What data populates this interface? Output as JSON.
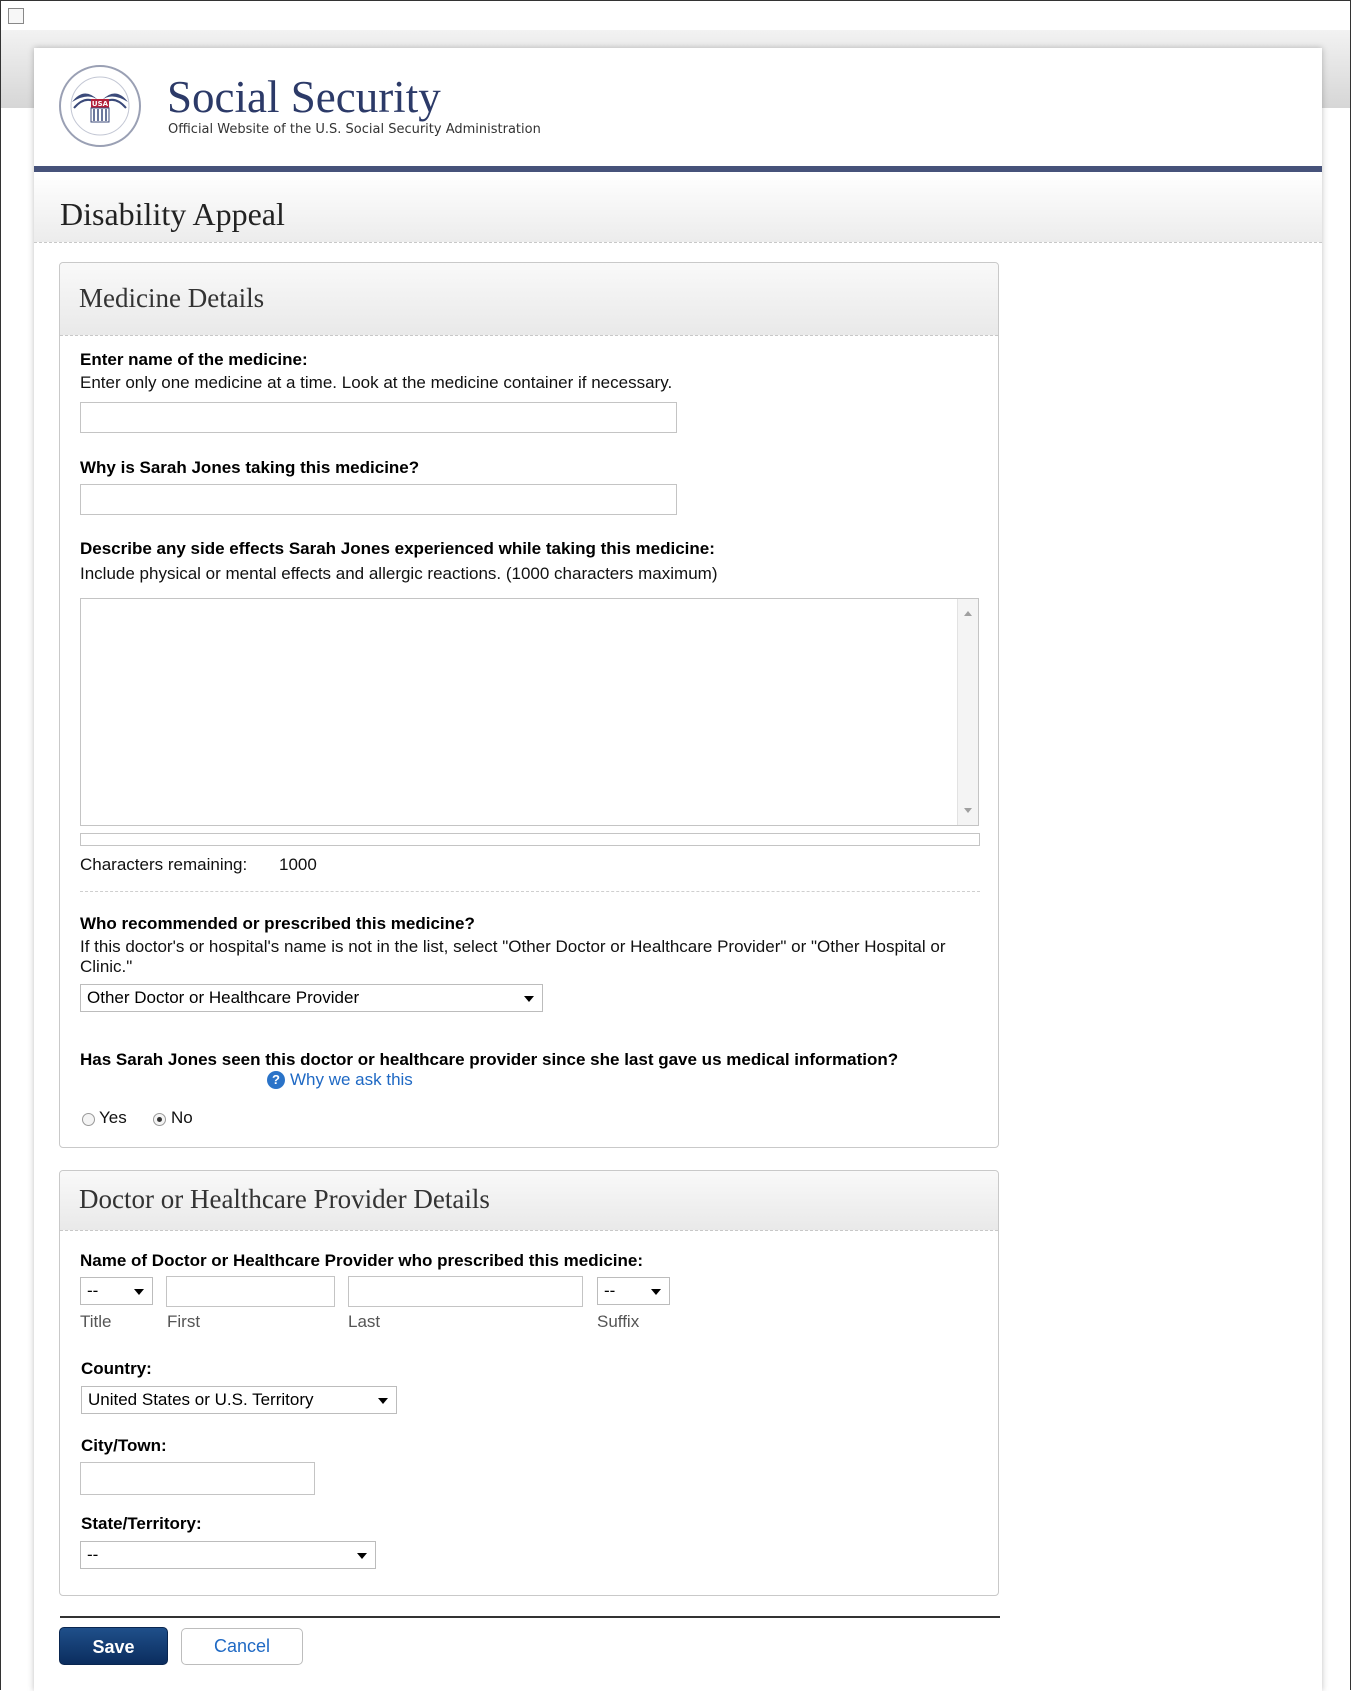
{
  "header": {
    "site_title": "Social Security",
    "site_subtitle": "Official Website of the U.S. Social Security Administration",
    "seal_text": "SOCIAL SECURITY ADMINISTRATION USA"
  },
  "page_title": "Disability Appeal",
  "medicine": {
    "section_title": "Medicine Details",
    "name_label": "Enter name of the medicine:",
    "name_hint": "Enter only one medicine at a time. Look at the medicine container if necessary.",
    "name_value": "",
    "why_label": "Why is Sarah Jones taking this medicine?",
    "why_value": "",
    "side_effects_label": "Describe any side effects Sarah Jones experienced while taking this medicine:",
    "side_effects_hint": "Include physical or mental effects and allergic reactions. (1000 characters maximum)",
    "side_effects_value": "",
    "chars_label": "Characters remaining:",
    "chars_value": "1000",
    "prescriber_label": "Who recommended or prescribed this medicine?",
    "prescriber_hint": "If this doctor's or hospital's name is not in the list, select \"Other Doctor or Healthcare Provider\" or \"Other Hospital or Clinic.\"",
    "prescriber_selected": "Other Doctor or Healthcare Provider",
    "seen_label": "Has Sarah Jones seen this doctor or healthcare provider since she last gave us medical information?",
    "why_ask_link": "Why we ask this",
    "help_icon_glyph": "?",
    "yes_label": "Yes",
    "no_label": "No",
    "seen_selected": "No"
  },
  "doctor": {
    "section_title": "Doctor or Healthcare Provider Details",
    "name_label": "Name of Doctor or Healthcare Provider who prescribed this medicine:",
    "title_selected": "--",
    "first_value": "",
    "last_value": "",
    "suffix_selected": "--",
    "title_sub": "Title",
    "first_sub": "First",
    "last_sub": "Last",
    "suffix_sub": "Suffix",
    "country_label": "Country:",
    "country_selected": "United States or U.S. Territory",
    "city_label": "City/Town:",
    "city_value": "",
    "state_label": "State/Territory:",
    "state_selected": "--"
  },
  "buttons": {
    "save": "Save",
    "cancel": "Cancel"
  },
  "colors": {
    "brand_navy": "#2c3a68",
    "header_bar": "#46527a",
    "save_button": "#0b2d5e",
    "link": "#1f69c4"
  }
}
